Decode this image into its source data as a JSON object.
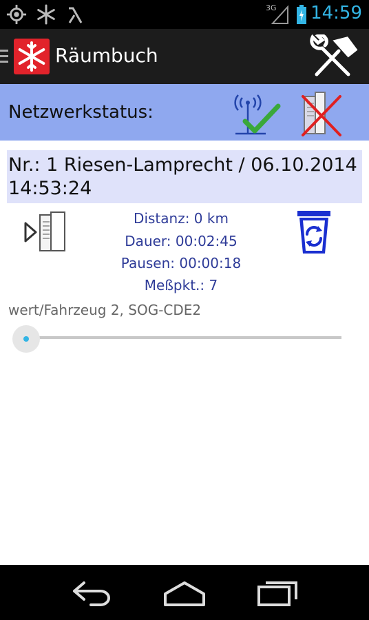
{
  "status_bar": {
    "time": "14:59",
    "network_type": "3G",
    "icons": [
      "location-icon",
      "snowflake-icon",
      "signal-app-icon",
      "signal-icon",
      "battery-icon"
    ],
    "time_color": "#33b5e5"
  },
  "action_bar": {
    "title": "Räumbuch",
    "logo_color": "#e2232b",
    "icons": [
      "menu-icon",
      "snowflake-logo-icon",
      "tools-icon"
    ]
  },
  "network": {
    "label": "Netzwerkstatus:",
    "band_color": "#8fa8ef",
    "icons": [
      "network-ok-icon",
      "delete-device-icon"
    ]
  },
  "record": {
    "title_line1": "Nr.: 1 Riesen-Lamprecht / 06.10.2014",
    "title_line2": "14:53:24",
    "distance": "Distanz: 0 km",
    "duration": "Dauer: 00:02:45",
    "pauses": "Pausen: 00:00:18",
    "points": "Meßpkt.: 7",
    "vehicle": "wert/Fahrzeug 2, SOG-CDE2",
    "progress_fraction": 0.0,
    "stat_color": "#2e3b98",
    "icons": [
      "play-device-icon",
      "recycle-bin-icon"
    ]
  },
  "nav_bar": {
    "buttons": [
      "back-icon",
      "home-icon",
      "recent-apps-icon"
    ]
  }
}
